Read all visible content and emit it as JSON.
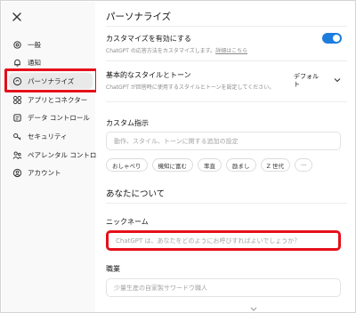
{
  "sidebar": {
    "items": [
      {
        "label": "一般",
        "icon": "gear-icon"
      },
      {
        "label": "通知",
        "icon": "bell-icon"
      },
      {
        "label": "パーソナライズ",
        "icon": "personalize-icon",
        "active": true
      },
      {
        "label": "アプリとコネクター",
        "icon": "apps-grid-icon"
      },
      {
        "label": "データ コントロール",
        "icon": "data-control-icon"
      },
      {
        "label": "セキュリティ",
        "icon": "shield-key-icon"
      },
      {
        "label": "ペアレンタル コントロール",
        "icon": "people-icon"
      },
      {
        "label": "アカウント",
        "icon": "account-icon"
      }
    ]
  },
  "main": {
    "title": "パーソナライズ",
    "enable_custom": {
      "label": "カスタマイズを有効にする",
      "desc": "ChatGPT の応答方法をカスタマイズします。",
      "link": "詳細はこちら",
      "enabled": true
    },
    "base_style": {
      "label": "基本的なスタイルとトーン",
      "desc": "ChatGPT が回答時に使用するスタイルとトーンを設定してください。",
      "value_line1": "デフォル",
      "value_line2": "ト"
    },
    "custom_instructions": {
      "label": "カスタム指示",
      "placeholder": "動作、スタイル、トーンに関する追加の設定",
      "chips": [
        "おしゃべり",
        "機知に富む",
        "率直",
        "励まし",
        "Z 世代",
        "···"
      ]
    },
    "about_you": {
      "heading": "あなたについて",
      "nickname_label": "ニックネーム",
      "nickname_placeholder": "ChatGPT は、あなたをどのようにお呼びすればよいでしょうか？",
      "occupation_label": "職業",
      "occupation_placeholder": "少量生産の自家製サワードウ職人"
    }
  },
  "colors": {
    "accent": "#1c7dde",
    "highlight": "#e5101a",
    "sidebar_bg": "#f9f9f9"
  }
}
